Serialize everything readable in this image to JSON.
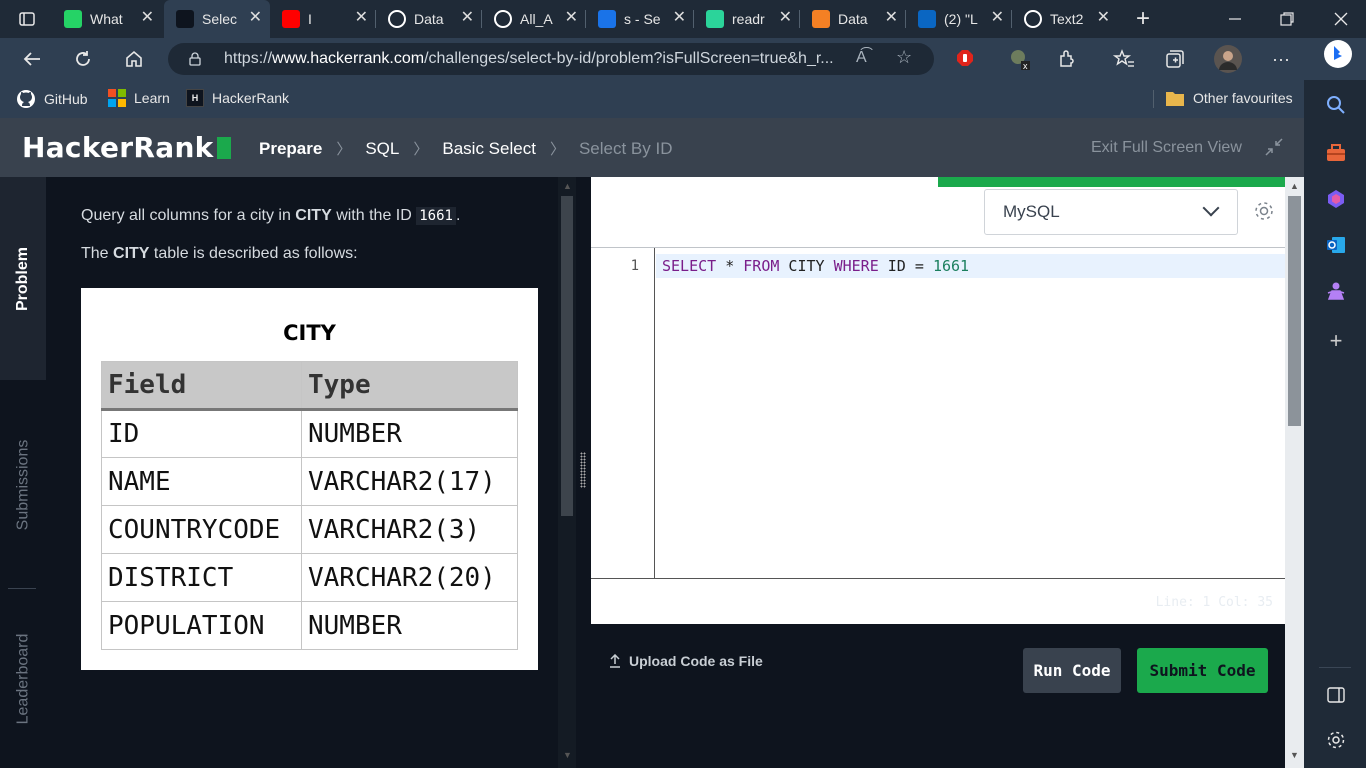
{
  "browser": {
    "tabs": [
      {
        "title": "What",
        "icon": "whatsapp-icon",
        "color": "#25d366"
      },
      {
        "title": "Selec",
        "icon": "hackerrank-icon",
        "color": "#0e141e",
        "active": true
      },
      {
        "title": "I",
        "icon": "youtube-icon",
        "color": "#ff0000"
      },
      {
        "title": "Data",
        "icon": "github-icon",
        "color": "#ffffff"
      },
      {
        "title": "All_A",
        "icon": "github-icon",
        "color": "#ffffff"
      },
      {
        "title": "s - Se",
        "icon": "search-icon",
        "color": "#1a73e8"
      },
      {
        "title": "readr",
        "icon": "readme-icon",
        "color": "#2bd49a"
      },
      {
        "title": "Data",
        "icon": "package-icon",
        "color": "#f48024"
      },
      {
        "title": "(2) \"L",
        "icon": "linkedin-icon",
        "color": "#0a66c2"
      },
      {
        "title": "Text2",
        "icon": "triangle-icon",
        "color": "#ffffff"
      }
    ],
    "url_prefix": "https://",
    "url_domain": "www.hackerrank.com",
    "url_path": "/challenges/select-by-id/problem?isFullScreen=true&h_r...",
    "bookmarks": {
      "github": "GitHub",
      "learn": "Learn",
      "hackerrank": "HackerRank",
      "other": "Other favourites"
    }
  },
  "header": {
    "logo": "HackerRank",
    "crumbs": {
      "prepare": "Prepare",
      "sql": "SQL",
      "basic": "Basic Select",
      "current": "Select By ID"
    },
    "exit": "Exit Full Screen View"
  },
  "side_tabs": {
    "problem": "Problem",
    "submissions": "Submissions",
    "leaderboard": "Leaderboard"
  },
  "problem": {
    "line1_a": "Query all columns for a city in ",
    "line1_b": "CITY",
    "line1_c": " with the ID ",
    "line1_code": "1661",
    "line1_d": ".",
    "line2_a": "The ",
    "line2_b": "CITY",
    "line2_c": " table is described as follows:",
    "table_title": "CITY",
    "table_headers": [
      "Field",
      "Type"
    ],
    "table_rows": [
      [
        "ID",
        "NUMBER"
      ],
      [
        "NAME",
        "VARCHAR2(17)"
      ],
      [
        "COUNTRYCODE",
        "VARCHAR2(3)"
      ],
      [
        "DISTRICT",
        "VARCHAR2(20)"
      ],
      [
        "POPULATION",
        "NUMBER"
      ]
    ]
  },
  "editor": {
    "language": "MySQL",
    "line_number": "1",
    "code": {
      "k1": "SELECT",
      "t1": " * ",
      "k2": "FROM",
      "t2": " CITY ",
      "k3": "WHERE",
      "t3": " ID = ",
      "n": "1661"
    },
    "status": "Line: 1 Col: 35",
    "upload": "Upload Code as File",
    "run": "Run Code",
    "submit": "Submit Code"
  }
}
